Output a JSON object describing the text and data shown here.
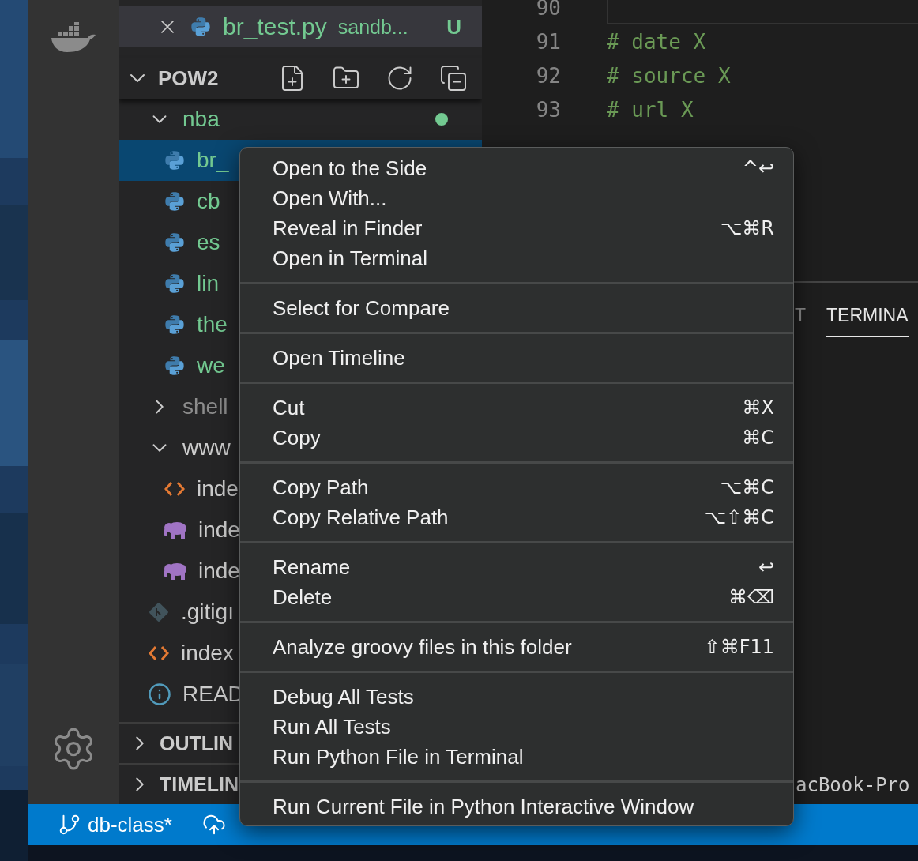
{
  "open_editors": [
    {
      "name": "br_test.py",
      "path": "sandb...",
      "badge": "U",
      "selected": true
    }
  ],
  "explorer": {
    "title": "POW2",
    "expanded": true,
    "tree": [
      {
        "kind": "folder",
        "name": "nba",
        "expanded": true,
        "untracked": true,
        "color": "#73c991",
        "children": [
          {
            "kind": "python",
            "name": "br_",
            "selected": true,
            "untracked": true
          },
          {
            "kind": "python",
            "name": "cb",
            "selected": false,
            "untracked": true
          },
          {
            "kind": "python",
            "name": "es",
            "selected": false,
            "untracked": true
          },
          {
            "kind": "python",
            "name": "lin",
            "selected": false,
            "untracked": true
          },
          {
            "kind": "python",
            "name": "the",
            "selected": false,
            "untracked": true
          },
          {
            "kind": "python",
            "name": "we",
            "selected": false,
            "untracked": true
          }
        ]
      },
      {
        "kind": "folder",
        "name": "shell",
        "expanded": false,
        "ignored": true
      },
      {
        "kind": "folder",
        "name": "www",
        "expanded": true,
        "children": [
          {
            "kind": "html",
            "name": "inde",
            "selected": false
          },
          {
            "kind": "php",
            "name": "inde",
            "selected": false
          },
          {
            "kind": "php",
            "name": "inde",
            "selected": false
          }
        ]
      },
      {
        "kind": "git",
        "name": ".gitigı",
        "selected": false
      },
      {
        "kind": "html",
        "name": "index",
        "selected": false
      },
      {
        "kind": "info",
        "name": "READ",
        "selected": false
      }
    ]
  },
  "sections": [
    {
      "title": "OUTLIN",
      "expanded": false
    },
    {
      "title": "TIMELIN",
      "expanded": false
    }
  ],
  "editor": {
    "lines": [
      {
        "number": "90",
        "kind": "widget"
      },
      {
        "number": "91",
        "text": "# date X"
      },
      {
        "number": "92",
        "text": "# source X"
      },
      {
        "number": "93",
        "text": "# url X"
      }
    ]
  },
  "panel": {
    "tabs": [
      {
        "label": "T",
        "selected": false
      },
      {
        "label": "TERMINA",
        "selected": true
      }
    ],
    "terminal_text": "acBook-Pro"
  },
  "status_bar": {
    "branch": "db-class*"
  },
  "context_menu": [
    [
      {
        "label": "Open to the Side",
        "shortcut": "^↩"
      },
      {
        "label": "Open With..."
      },
      {
        "label": "Reveal in Finder",
        "shortcut": "⌥⌘R"
      },
      {
        "label": "Open in Terminal"
      }
    ],
    [
      {
        "label": "Select for Compare"
      }
    ],
    [
      {
        "label": "Open Timeline"
      }
    ],
    [
      {
        "label": "Cut",
        "shortcut": "⌘X"
      },
      {
        "label": "Copy",
        "shortcut": "⌘C"
      }
    ],
    [
      {
        "label": "Copy Path",
        "shortcut": "⌥⌘C"
      },
      {
        "label": "Copy Relative Path",
        "shortcut": "⌥⇧⌘C"
      }
    ],
    [
      {
        "label": "Rename",
        "shortcut": "↩"
      },
      {
        "label": "Delete",
        "shortcut": "⌘⌫"
      }
    ],
    [
      {
        "label": "Analyze groovy files in this folder",
        "shortcut": "⇧⌘F11"
      }
    ],
    [
      {
        "label": "Debug All Tests"
      },
      {
        "label": "Run All Tests"
      },
      {
        "label": "Run Python File in Terminal"
      }
    ],
    [
      {
        "label": "Run Current File in Python Interactive Window"
      }
    ]
  ]
}
